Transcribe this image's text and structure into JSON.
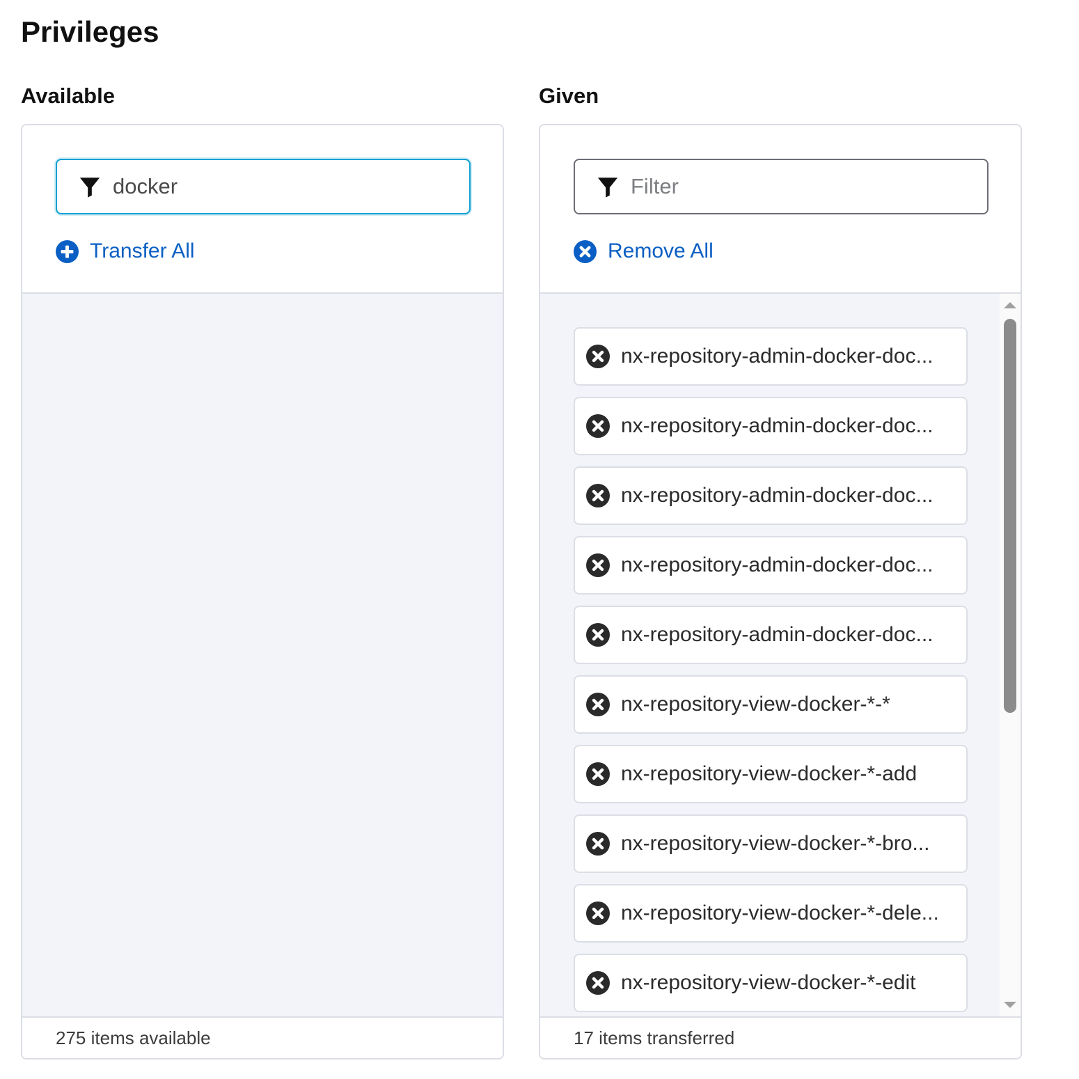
{
  "page": {
    "title": "Privileges"
  },
  "available": {
    "heading": "Available",
    "filter_value": "docker",
    "filter_placeholder": "Filter",
    "action_label": "Transfer All",
    "footer": "275 items available",
    "items": []
  },
  "given": {
    "heading": "Given",
    "filter_value": "",
    "filter_placeholder": "Filter",
    "action_label": "Remove All",
    "footer": "17 items transferred",
    "items": [
      "nx-repository-admin-docker-doc...",
      "nx-repository-admin-docker-doc...",
      "nx-repository-admin-docker-doc...",
      "nx-repository-admin-docker-doc...",
      "nx-repository-admin-docker-doc...",
      "nx-repository-view-docker-*-*",
      "nx-repository-view-docker-*-add",
      "nx-repository-view-docker-*-bro...",
      "nx-repository-view-docker-*-dele...",
      "nx-repository-view-docker-*-edit"
    ]
  },
  "icons": {
    "filter": "filter-icon",
    "add": "plus-circle-icon",
    "remove": "x-circle-icon"
  },
  "colors": {
    "link": "#0b5fc4",
    "focus_border": "#0fa0d2",
    "list_background": "#f3f4f9",
    "item_remove_icon": "#2a2a2a"
  }
}
